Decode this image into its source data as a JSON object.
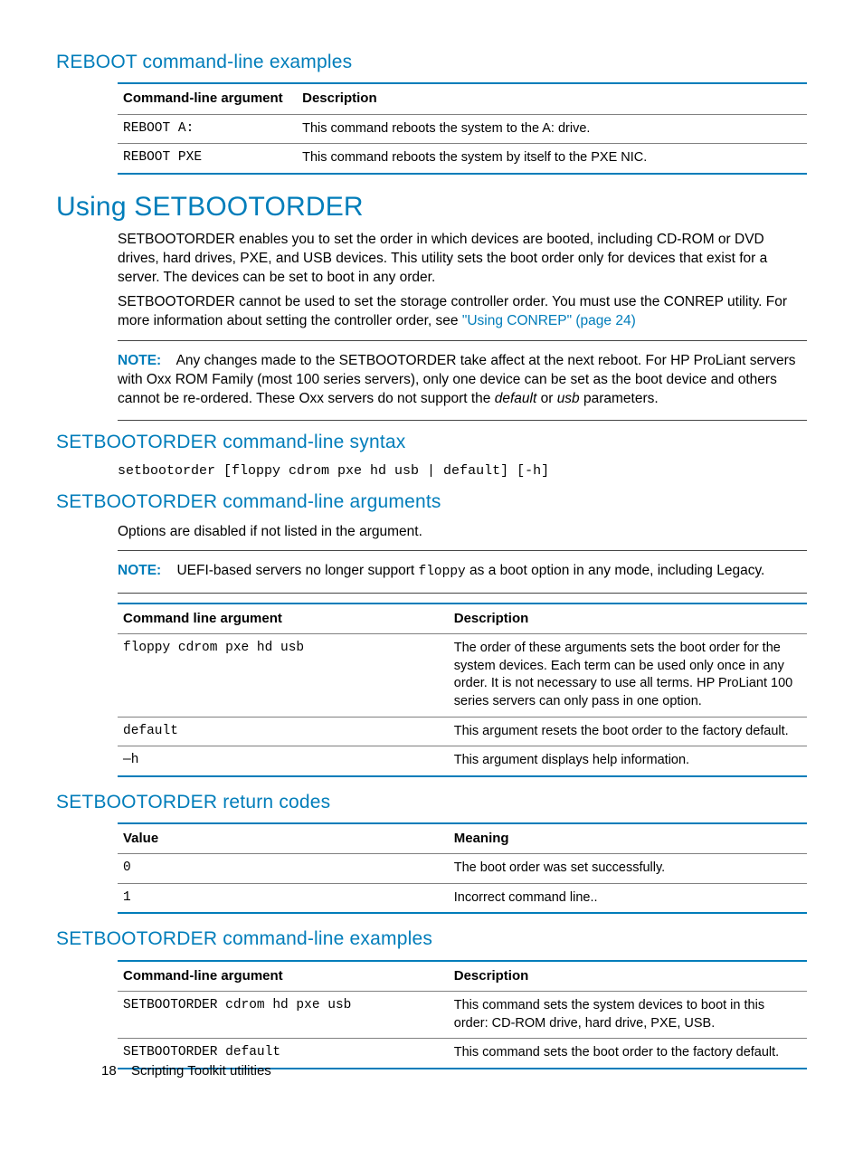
{
  "sect_reboot_examples": {
    "heading": "REBOOT command-line examples",
    "headers": [
      "Command-line argument",
      "Description"
    ],
    "rows": [
      {
        "arg": "REBOOT A:",
        "desc": "This command reboots the system to the A: drive."
      },
      {
        "arg": "REBOOT PXE",
        "desc": "This command reboots the system by itself to the PXE NIC."
      }
    ]
  },
  "sect_using": {
    "heading": "Using SETBOOTORDER",
    "para1": "SETBOOTORDER enables you to set the order in which devices are booted, including CD-ROM or DVD drives, hard drives, PXE, and USB devices. This utility sets the boot order only for devices that exist for a server. The devices can be set to boot in any order.",
    "para2a": "SETBOOTORDER cannot be used to set the storage controller order. You must use the CONREP utility. For more information about setting the controller order, see ",
    "para2link": "\"Using CONREP\" (page 24)",
    "note_label": "NOTE:",
    "note_body_a": "Any changes made to the SETBOOTORDER take affect at the next reboot. For HP ProLiant servers with Oxx ROM Family (most 100 series servers), only one device can be set as the boot device and others cannot be re-ordered. These Oxx servers do not support the ",
    "note_em1": "default",
    "note_mid": " or ",
    "note_em2": "usb",
    "note_body_b": " parameters."
  },
  "sect_syntax": {
    "heading": "SETBOOTORDER command-line syntax",
    "code": "setbootorder [floppy cdrom pxe hd usb | default] [-h]"
  },
  "sect_args": {
    "heading": "SETBOOTORDER command-line arguments",
    "para": "Options are disabled if not listed in the argument.",
    "note_label": "NOTE:",
    "note_a": "UEFI-based servers no longer support ",
    "note_code": "floppy",
    "note_b": " as a boot option in any mode, including Legacy.",
    "headers": [
      "Command line argument",
      "Description"
    ],
    "rows": [
      {
        "arg": "floppy cdrom pxe hd usb",
        "desc": "The order of these arguments sets the boot order for the system devices. Each term can be used only once in any order. It is not necessary to use all terms. HP ProLiant 100 series servers can only pass in one option."
      },
      {
        "arg": "default",
        "desc": "This argument resets the boot order to the factory default."
      },
      {
        "arg": "—h",
        "desc": "This argument displays help information."
      }
    ]
  },
  "sect_return": {
    "heading": "SETBOOTORDER return codes",
    "headers": [
      "Value",
      "Meaning"
    ],
    "rows": [
      {
        "val": "0",
        "desc": "The boot order was set successfully."
      },
      {
        "val": "1",
        "desc": "Incorrect command line.."
      }
    ]
  },
  "sect_examples": {
    "heading": "SETBOOTORDER command-line examples",
    "headers": [
      "Command-line argument",
      "Description"
    ],
    "rows": [
      {
        "arg": "SETBOOTORDER cdrom hd pxe usb",
        "desc": "This command sets the system devices to boot in this order: CD-ROM drive, hard drive, PXE, USB."
      },
      {
        "arg": "SETBOOTORDER default",
        "desc": "This command sets the boot order to the factory default."
      }
    ]
  },
  "footer": {
    "page": "18",
    "title": "Scripting Toolkit utilities"
  }
}
